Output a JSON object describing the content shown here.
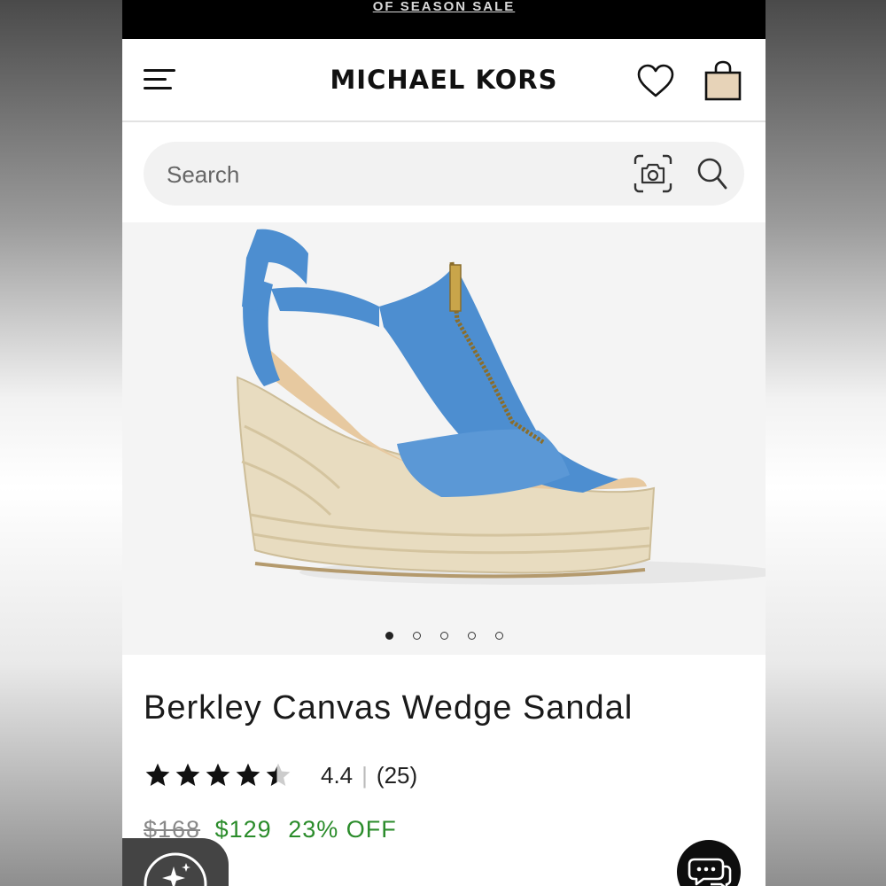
{
  "promo": {
    "text": "OF SEASON SALE"
  },
  "header": {
    "brand": "MICHAEL KORS",
    "icons": [
      "hamburger-menu-icon",
      "heart-icon",
      "shopping-bag-icon"
    ]
  },
  "search": {
    "placeholder": "Search",
    "icons": [
      "camera-icon",
      "search-icon"
    ]
  },
  "gallery": {
    "image_count": 5,
    "active_index": 0
  },
  "product": {
    "title": "Berkley Canvas Wedge Sandal",
    "rating": {
      "score": "4.4",
      "separator": "|",
      "count": "(25)",
      "stars_value": 4.4,
      "stars_max": 5
    },
    "price": {
      "original": "$168",
      "sale": "$129",
      "discount": "23% OFF"
    }
  },
  "colors": {
    "sale_green": "#2b8c2b",
    "shoe_blue": "#4d8ed0",
    "jute": "#e8dcc0",
    "bag_fill": "#e7d3b8"
  },
  "floating": {
    "icons": [
      "sparkle-assistant-icon",
      "chat-bubble-icon"
    ]
  }
}
